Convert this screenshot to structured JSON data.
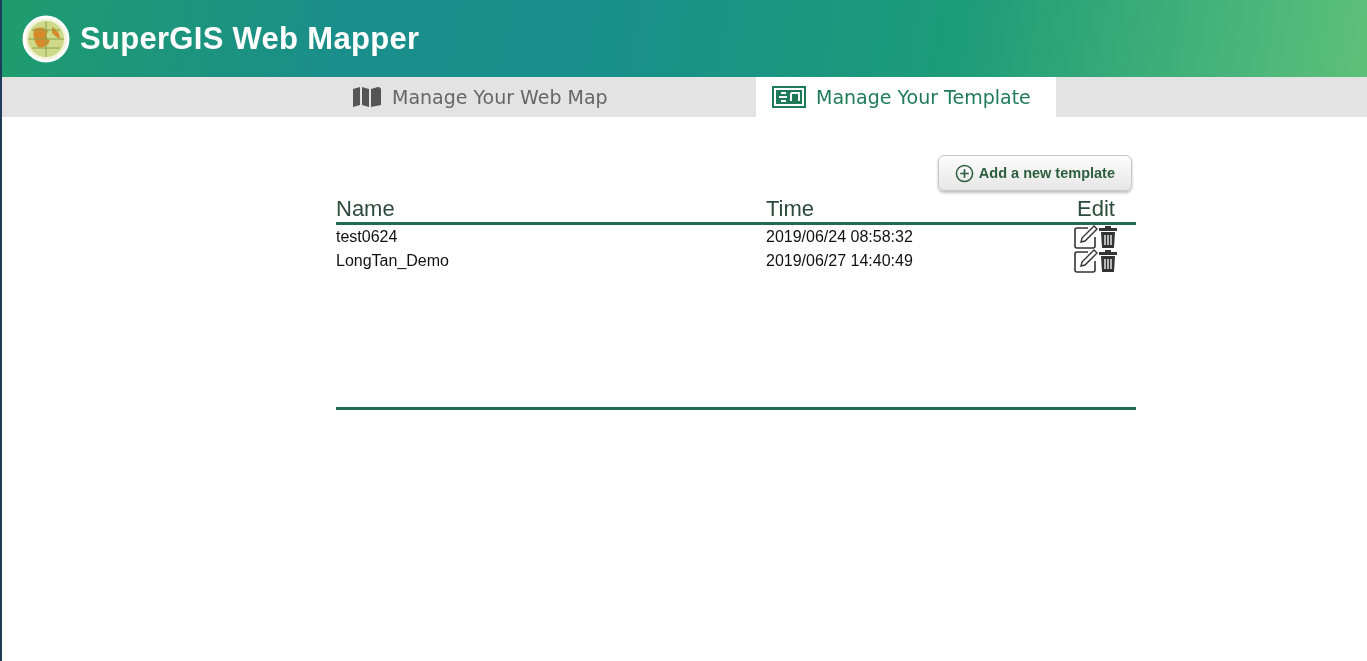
{
  "header": {
    "title": "SuperGIS Web Mapper"
  },
  "tabs": [
    {
      "label": "Manage Your Web Map",
      "kind": "map",
      "selected": false
    },
    {
      "label": "Manage Your Template",
      "kind": "template",
      "selected": true
    }
  ],
  "add_button": {
    "label": "Add a new template"
  },
  "table": {
    "columns": [
      "Name",
      "Time",
      "Edit"
    ],
    "rows": [
      {
        "name": "test0624",
        "time": "2019/06/24 08:58:32"
      },
      {
        "name": "LongTan_Demo",
        "time": "2019/06/27 14:40:49"
      }
    ]
  }
}
